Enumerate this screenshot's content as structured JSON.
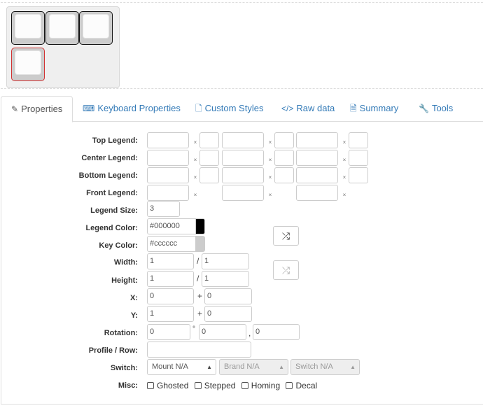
{
  "tabs": [
    {
      "label": "Properties",
      "icon": "✎",
      "icon_name": "edit-icon"
    },
    {
      "label": "Keyboard Properties",
      "icon": "⌨",
      "icon_name": "keyboard-icon"
    },
    {
      "label": "Custom Styles",
      "icon": "🗋",
      "icon_name": "file-icon"
    },
    {
      "label": "Raw data",
      "icon": "</>",
      "icon_name": "code-icon"
    },
    {
      "label": "Summary",
      "icon": "🗎",
      "icon_name": "file-text-icon"
    },
    {
      "label": "Tools",
      "icon": "🔧",
      "icon_name": "wrench-icon"
    }
  ],
  "labels": {
    "top_legend": "Top Legend:",
    "center_legend": "Center Legend:",
    "bottom_legend": "Bottom Legend:",
    "front_legend": "Front Legend:",
    "legend_size": "Legend Size:",
    "legend_color": "Legend Color:",
    "key_color": "Key Color:",
    "width": "Width:",
    "height": "Height:",
    "x": "X:",
    "y": "Y:",
    "rotation": "Rotation:",
    "profile_row": "Profile / Row:",
    "switch": "Switch:",
    "misc": "Misc:"
  },
  "values": {
    "legend_size": "3",
    "legend_color": "#000000",
    "key_color": "#cccccc",
    "width": "1",
    "width2": "1",
    "height": "1",
    "height2": "1",
    "x": "0",
    "x2": "0",
    "y": "1",
    "y2": "0",
    "rotation": "0",
    "rotation_x": "0",
    "rotation_y": "0",
    "profile_row": ""
  },
  "colors": {
    "legend_color_swatch": "#000000",
    "key_color_swatch": "#cccccc",
    "selected_key_border": "#d23232",
    "link_color": "#337ab7"
  },
  "separators": {
    "slash": "/",
    "plus": "+",
    "degree": "°",
    "comma": ","
  },
  "clear_glyph": "×",
  "shuffle_glyph": "⤮",
  "switch": {
    "mount": "Mount N/A",
    "brand": "Brand N/A",
    "type": "Switch N/A",
    "caret": "▲"
  },
  "misc": {
    "ghosted": "Ghosted",
    "stepped": "Stepped",
    "homing": "Homing",
    "decal": "Decal"
  }
}
